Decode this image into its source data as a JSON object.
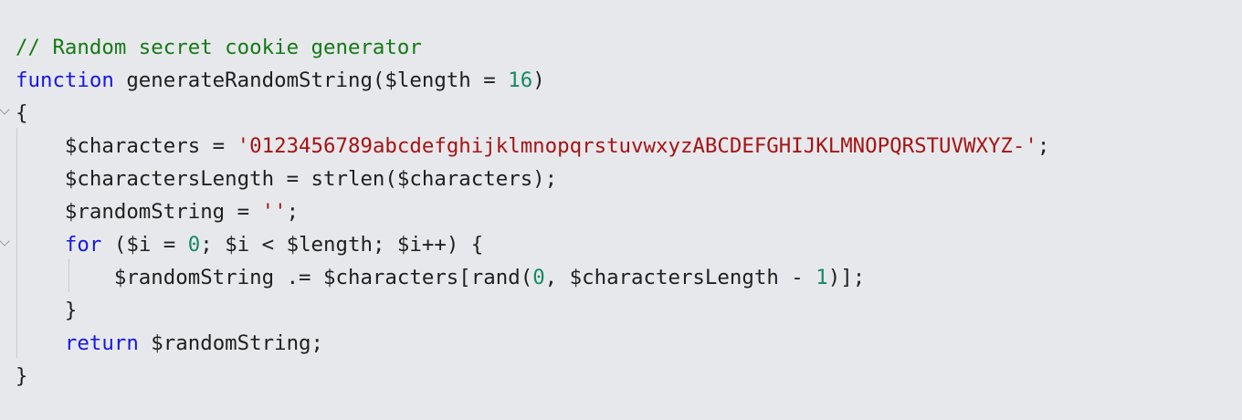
{
  "code_lines": [
    [
      {
        "text": "// Random secret cookie generator",
        "kind": "comment"
      }
    ],
    [
      {
        "text": "function",
        "kind": "keyword"
      },
      {
        "text": " generateRandomString($length = ",
        "kind": "plain"
      },
      {
        "text": "16",
        "kind": "number"
      },
      {
        "text": ")",
        "kind": "plain"
      }
    ],
    [
      {
        "text": "{",
        "kind": "plain"
      }
    ],
    [
      {
        "text": "    $characters = ",
        "kind": "plain"
      },
      {
        "text": "'0123456789abcdefghijklmnopqrstuvwxyzABCDEFGHIJKLMNOPQRSTUVWXYZ-'",
        "kind": "string"
      },
      {
        "text": ";",
        "kind": "plain"
      }
    ],
    [
      {
        "text": "    $charactersLength = strlen($characters);",
        "kind": "plain"
      }
    ],
    [
      {
        "text": "    $randomString = ",
        "kind": "plain"
      },
      {
        "text": "''",
        "kind": "string"
      },
      {
        "text": ";",
        "kind": "plain"
      }
    ],
    [
      {
        "text": "    ",
        "kind": "plain"
      },
      {
        "text": "for",
        "kind": "keyword"
      },
      {
        "text": " ($i = ",
        "kind": "plain"
      },
      {
        "text": "0",
        "kind": "number"
      },
      {
        "text": "; $i < $length; $i++) {",
        "kind": "plain"
      }
    ],
    [
      {
        "text": "        $randomString .= $characters[rand(",
        "kind": "plain"
      },
      {
        "text": "0",
        "kind": "number"
      },
      {
        "text": ", $charactersLength - ",
        "kind": "plain"
      },
      {
        "text": "1",
        "kind": "number"
      },
      {
        "text": ")];",
        "kind": "plain"
      }
    ],
    [
      {
        "text": "    }",
        "kind": "plain"
      }
    ],
    [
      {
        "text": "    ",
        "kind": "plain"
      },
      {
        "text": "return",
        "kind": "keyword"
      },
      {
        "text": " $randomString;",
        "kind": "plain"
      }
    ],
    [
      {
        "text": "}",
        "kind": "plain"
      }
    ]
  ],
  "colors": {
    "background": "#e7e8ec",
    "comment": "#147a14",
    "keyword": "#1717e0",
    "string": "#a31515",
    "number": "#158a62",
    "plain": "#1f1f1f"
  }
}
